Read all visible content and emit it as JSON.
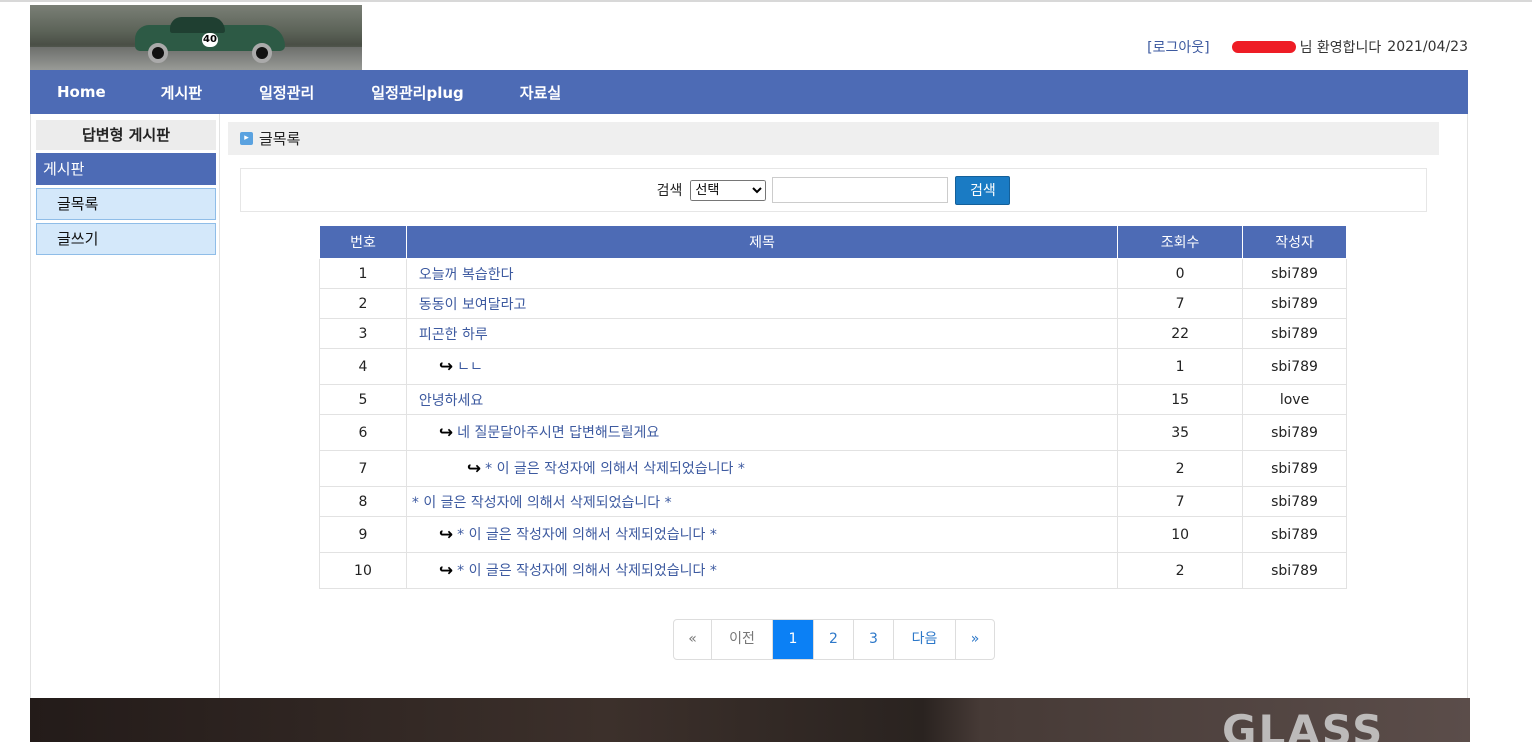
{
  "header": {
    "logout_label": "[로그아웃]",
    "welcome_suffix": "님 환영합니다",
    "date": "2021/04/23"
  },
  "nav": {
    "items": [
      {
        "label": "Home"
      },
      {
        "label": "게시판"
      },
      {
        "label": "일정관리"
      },
      {
        "label": "일정관리plug"
      },
      {
        "label": "자료실"
      }
    ]
  },
  "sidebar": {
    "title": "답변형 게시판",
    "section": "게시판",
    "items": [
      {
        "label": "글목록"
      },
      {
        "label": "글쓰기"
      }
    ]
  },
  "content": {
    "title": "글목록"
  },
  "search": {
    "label": "검색",
    "select_value": "선택",
    "input_value": "",
    "button_label": "검색"
  },
  "table": {
    "headers": [
      "번호",
      "제목",
      "조회수",
      "작성자"
    ],
    "rows": [
      {
        "num": "1",
        "title": "오늘꺼 복습한다",
        "views": "0",
        "author": "sbi789",
        "depth": 0,
        "deleted": false
      },
      {
        "num": "2",
        "title": "동동이 보여달라고",
        "views": "7",
        "author": "sbi789",
        "depth": 0,
        "deleted": false
      },
      {
        "num": "3",
        "title": "피곤한 하루",
        "views": "22",
        "author": "sbi789",
        "depth": 0,
        "deleted": false
      },
      {
        "num": "4",
        "title": "ㄴㄴ",
        "views": "1",
        "author": "sbi789",
        "depth": 1,
        "deleted": false
      },
      {
        "num": "5",
        "title": "안녕하세요",
        "views": "15",
        "author": "love",
        "depth": 0,
        "deleted": false
      },
      {
        "num": "6",
        "title": "네 질문달아주시면 답변해드릴게요",
        "views": "35",
        "author": "sbi789",
        "depth": 1,
        "deleted": false
      },
      {
        "num": "7",
        "title": "* 이 글은 작성자에 의해서 삭제되었습니다 *",
        "views": "2",
        "author": "sbi789",
        "depth": 2,
        "deleted": true
      },
      {
        "num": "8",
        "title": "* 이 글은 작성자에 의해서 삭제되었습니다 *",
        "views": "7",
        "author": "sbi789",
        "depth": 0,
        "deleted": true
      },
      {
        "num": "9",
        "title": "* 이 글은 작성자에 의해서 삭제되었습니다 *",
        "views": "10",
        "author": "sbi789",
        "depth": 1,
        "deleted": true
      },
      {
        "num": "10",
        "title": "* 이 글은 작성자에 의해서 삭제되었습니다 *",
        "views": "2",
        "author": "sbi789",
        "depth": 1,
        "deleted": true
      }
    ]
  },
  "pager": {
    "first": "«",
    "prev": "이전",
    "pages": [
      "1",
      "2",
      "3"
    ],
    "active": "1",
    "next": "다음",
    "last": "»"
  },
  "footer": {
    "logo_text": "GLASS"
  },
  "colors": {
    "nav_bg": "#4d6bb5",
    "deleted_text": "#d61a1a",
    "link_text": "#3d5aa0",
    "active_page": "#0b80f5"
  }
}
